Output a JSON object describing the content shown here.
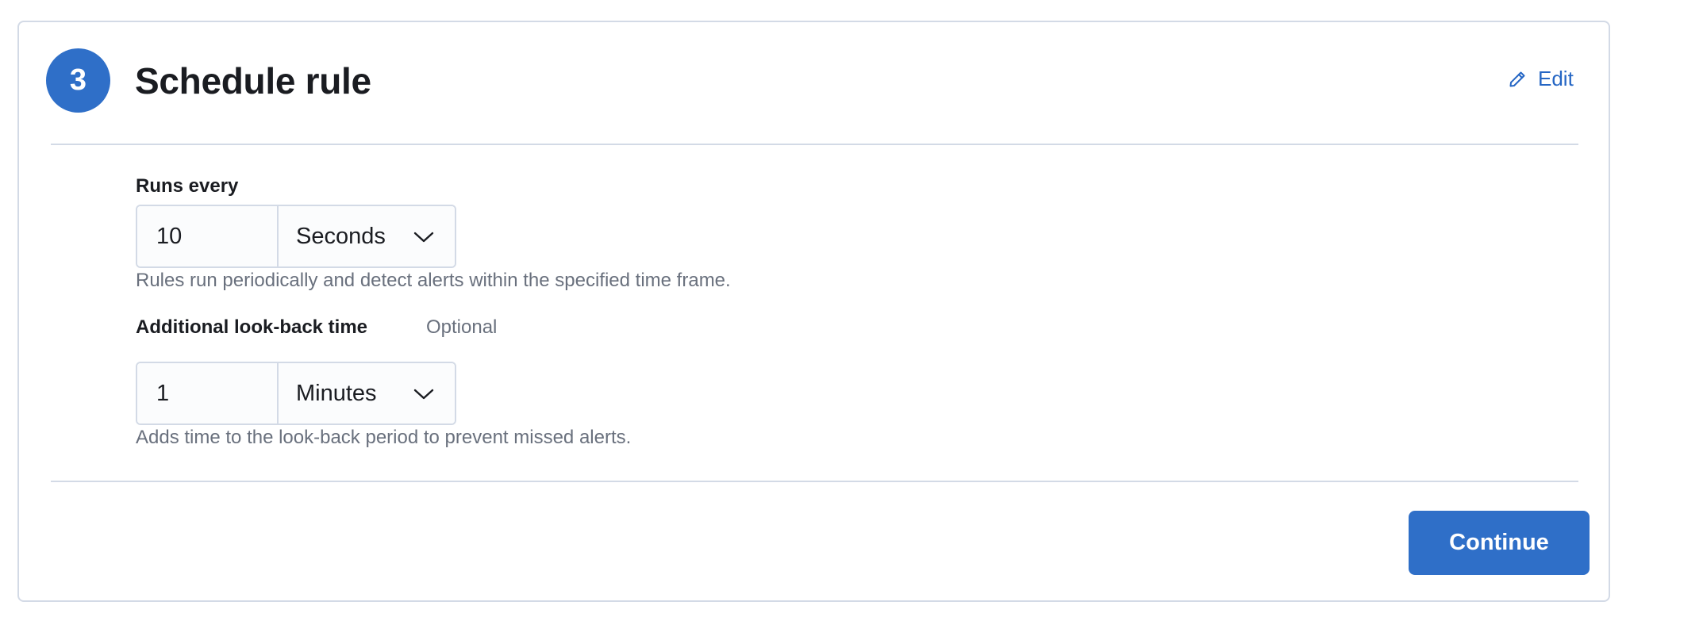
{
  "step": {
    "number": "3",
    "title": "Schedule rule",
    "edit_label": "Edit"
  },
  "runs_every": {
    "label": "Runs every",
    "value": "10",
    "unit": "Seconds",
    "help": "Rules run periodically and detect alerts within the specified time frame."
  },
  "look_back": {
    "label": "Additional look-back time",
    "optional_label": "Optional",
    "value": "1",
    "unit": "Minutes",
    "help": "Adds time to the look-back period to prevent missed alerts."
  },
  "actions": {
    "continue_label": "Continue"
  },
  "colors": {
    "accent": "#2f6fc8",
    "link": "#2566c4",
    "border": "#d3dae6",
    "subdued_text": "#69707d"
  },
  "icons": {
    "edit": "pencil-icon",
    "dropdown": "chevron-down-icon"
  }
}
